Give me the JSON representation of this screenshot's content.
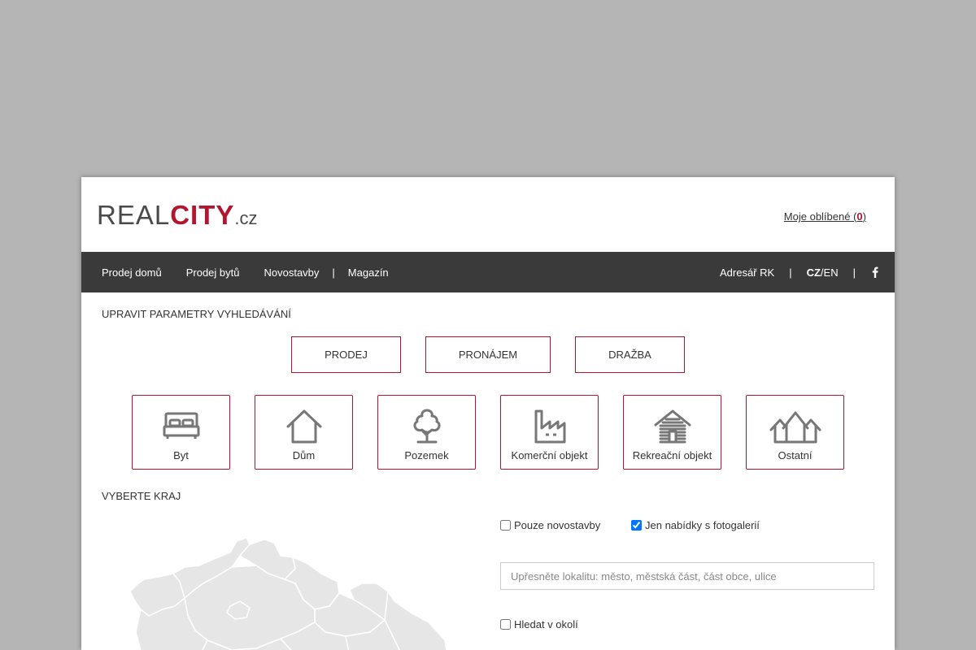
{
  "header": {
    "logo": {
      "part1": "REAL",
      "part2": "CITY",
      "part3": ".cz"
    },
    "favorites": {
      "label": "Moje oblíbené (",
      "count": "0",
      "suffix": ")"
    }
  },
  "nav": {
    "left": [
      "Prodej domů",
      "Prodej bytů",
      "Novostavby",
      "Magazín"
    ],
    "separator": "|",
    "right": {
      "directory": "Adresář RK",
      "lang_cz": "CZ",
      "lang_slash": "/",
      "lang_en": "EN"
    }
  },
  "search": {
    "title": "UPRAVIT PARAMETRY VYHLEDÁVÁNÍ",
    "transaction_types": [
      "PRODEJ",
      "PRONÁJEM",
      "DRAŽBA"
    ],
    "categories": [
      {
        "label": "Byt",
        "icon": "bed-icon"
      },
      {
        "label": "Dům",
        "icon": "house-icon"
      },
      {
        "label": "Pozemek",
        "icon": "tree-icon"
      },
      {
        "label": "Komerční objekt",
        "icon": "factory-icon"
      },
      {
        "label": "Rekreační objekt",
        "icon": "cabin-icon"
      },
      {
        "label": "Ostatní",
        "icon": "other-house-icon"
      }
    ],
    "region_title": "VYBERTE KRAJ",
    "options": {
      "new_only": {
        "label": "Pouze novostavby",
        "checked": false
      },
      "with_gallery": {
        "label": "Jen nabídky s fotogalerií",
        "checked": true
      },
      "nearby": {
        "label": "Hledat v okolí",
        "checked": false
      }
    },
    "location_placeholder": "Upřesněte lokalitu: město, městská část, část obce, ulice"
  },
  "colors": {
    "accent": "#b3152e",
    "nav_bg": "#3a3a3a",
    "page_bg": "#b5b5b5"
  }
}
